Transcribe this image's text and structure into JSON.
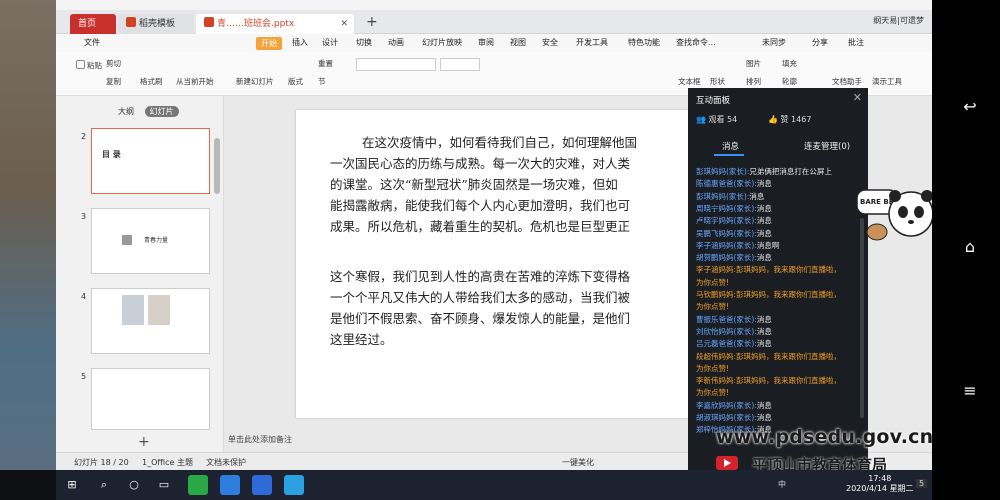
{
  "tabs": {
    "home": "首页",
    "template": "稻壳模板",
    "doc": "青……班班会.pptx"
  },
  "titlebar_right": "纲天易|可遗梦",
  "menu": [
    "文件",
    "开始",
    "插入",
    "设计",
    "切换",
    "动画",
    "幻灯片放映",
    "审阅",
    "视图",
    "安全",
    "开发工具",
    "特色功能",
    "查找命令...",
    "未同步",
    "分享",
    "批注"
  ],
  "ribbon": {
    "paste": "粘贴",
    "cut": "剪切",
    "copy": "复制",
    "format_painter": "格式刷",
    "from_current": "从当前开始",
    "new_slide": "新建幻灯片",
    "layout": "版式",
    "section": "节",
    "reset": "重置",
    "textbox": "文本框",
    "shape": "形状",
    "arrange": "排列",
    "outline": "轮廓",
    "fill": "填充",
    "picture": "图片",
    "assistant": "文档助手",
    "drawing_tools": "演示工具"
  },
  "thumbs": {
    "outline_tab": "大纲",
    "slide_tab": "幻灯片",
    "slides": [
      {
        "num": "2",
        "title": "目 录"
      },
      {
        "num": "3",
        "title": "青春力量"
      },
      {
        "num": "4",
        "title": ""
      },
      {
        "num": "5",
        "title": ""
      }
    ],
    "add": "+",
    "notes": "单击此处添加备注"
  },
  "slide": {
    "para1": "在这次疫情中，如何看待我们自己，如何理解他国\n一次国民心态的历练与成熟。每一次大的灾难，对人类\n的课堂。这次“新型冠状”肺炎固然是一场灾难，但如\n能揭露敝病，能使我们每个人内心更加澄明，我们也可\n成果。所以危机，藏着重生的契机。危机也是巨型更正",
    "para2": "这个寒假，我们见到人性的高贵在苦难的淬炼下变得格\n一个个平凡又伟大的人带给我们太多的感动，当我们被\n是他们不假思索、奋不顾身、爆发惊人的能量，是他们\n这里经过。"
  },
  "statusbar": {
    "slide_pos": "幻灯片 18 / 20",
    "theme": "1_Office 主题",
    "protect": "文档未保护",
    "beautify": "一键美化"
  },
  "panel": {
    "title": "互动面板",
    "viewers_label": "观看 54",
    "likes_label": "赞 1467",
    "tab_messages": "消息",
    "tab_mic": "连麦管理(0)",
    "messages": [
      {
        "name": "彭琪妈妈(家长):",
        "text": "兄弟俩把消息打在公屏上",
        "style": "blue"
      },
      {
        "name": "陈德惠爸爸(家长):",
        "text": "消息",
        "style": "blue"
      },
      {
        "name": "彭琪妈妈(家长):",
        "text": "消息",
        "style": "blue"
      },
      {
        "name": "周晓宁妈妈(家长):",
        "text": "消息",
        "style": "blue"
      },
      {
        "name": "卢晓宇妈妈(家长):",
        "text": "消息",
        "style": "blue"
      },
      {
        "name": "吴鹏飞妈妈(家长):",
        "text": "消息",
        "style": "blue"
      },
      {
        "name": "李子涵妈妈(家长):",
        "text": "消息啊",
        "style": "blue"
      },
      {
        "name": "胡贺鹏妈妈(家长):",
        "text": "消息",
        "style": "blue"
      },
      {
        "name": "李子涵妈妈:",
        "text": "彭琪妈妈，我来跟你们直播啦，",
        "style": "orange"
      },
      {
        "name": "",
        "text": "为你点赞!",
        "style": "orange"
      },
      {
        "name": "马钦鹏妈妈:",
        "text": "彭琪妈妈，我来跟你们直播啦，",
        "style": "orange"
      },
      {
        "name": "",
        "text": "为你点赞!",
        "style": "orange"
      },
      {
        "name": "曹振乐爸爸(家长):",
        "text": "消息",
        "style": "blue"
      },
      {
        "name": "刘欣怡妈妈(家长):",
        "text": "消息",
        "style": "blue"
      },
      {
        "name": "吕元磊爸爸(家长):",
        "text": "消息",
        "style": "blue"
      },
      {
        "name": "段超伟妈妈:",
        "text": "彭琪妈妈，我来跟你们直播啦，",
        "style": "orange"
      },
      {
        "name": "",
        "text": "为你点赞!",
        "style": "orange"
      },
      {
        "name": "李新伟妈妈:",
        "text": "彭琪妈妈，我来跟你们直播啦，",
        "style": "orange"
      },
      {
        "name": "",
        "text": "为你点赞!",
        "style": "orange"
      },
      {
        "name": "李嘉欣妈妈(家长):",
        "text": "消息",
        "style": "blue"
      },
      {
        "name": "胡淑琪妈妈(家长):",
        "text": "消息",
        "style": "blue"
      },
      {
        "name": "郑梓怡妈妈(家长):",
        "text": "消息",
        "style": "blue"
      }
    ]
  },
  "watermark": {
    "url": "www.pdsedu.gov.cn",
    "org": "平顶山市教育体育局"
  },
  "sticker_text": "BARE BEARS",
  "taskbar": {
    "time": "17:48",
    "date": "2020/4/14 星期二",
    "lang": "中",
    "notification": "5"
  },
  "colors": {
    "accent": "#c9302c",
    "menu_start": "#f2a43a",
    "panel_bg": "#1a1d22",
    "msg_name": "#6aa8ff",
    "msg_highlight": "#f0a02a"
  }
}
